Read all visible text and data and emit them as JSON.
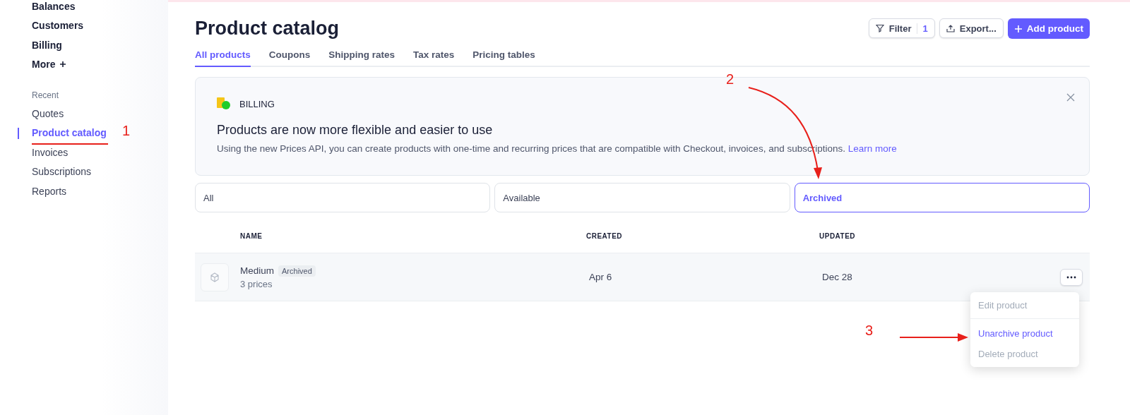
{
  "sidebar": {
    "items": [
      {
        "label": "Balances"
      },
      {
        "label": "Customers"
      },
      {
        "label": "Billing"
      },
      {
        "label": "More",
        "more": true
      }
    ],
    "recent_heading": "Recent",
    "recent": [
      {
        "label": "Quotes",
        "selected": false
      },
      {
        "label": "Product catalog",
        "selected": true
      },
      {
        "label": "Invoices",
        "selected": false
      },
      {
        "label": "Subscriptions",
        "selected": false
      },
      {
        "label": "Reports",
        "selected": false
      }
    ]
  },
  "title": "Product catalog",
  "actions": {
    "filter": "Filter",
    "filter_count": "1",
    "export": "Export...",
    "add": "Add product"
  },
  "tabs": [
    {
      "label": "All products",
      "selected": true
    },
    {
      "label": "Coupons",
      "selected": false
    },
    {
      "label": "Shipping rates",
      "selected": false
    },
    {
      "label": "Tax rates",
      "selected": false
    },
    {
      "label": "Pricing tables",
      "selected": false
    }
  ],
  "banner": {
    "tag": "BILLING",
    "heading": "Products are now more flexible and easier to use",
    "text": "Using the new Prices API, you can create products with one-time and recurring prices that are compatible with Checkout, invoices, and subscriptions.",
    "link": "Learn more"
  },
  "segments": [
    {
      "label": "All",
      "selected": false
    },
    {
      "label": "Available",
      "selected": false
    },
    {
      "label": "Archived",
      "selected": true
    }
  ],
  "table": {
    "columns": [
      "NAME",
      "CREATED",
      "UPDATED"
    ],
    "rows": [
      {
        "name": "Medium",
        "badge": "Archived",
        "prices": "3 prices",
        "created": "Apr 6",
        "updated": "Dec 28"
      }
    ]
  },
  "menu": {
    "items": [
      {
        "label": "Edit product",
        "disabled": true
      },
      {
        "label": "Unarchive product",
        "disabled": false
      },
      {
        "label": "Delete product",
        "disabled": true
      }
    ]
  },
  "annotations": [
    "1",
    "2",
    "3"
  ]
}
